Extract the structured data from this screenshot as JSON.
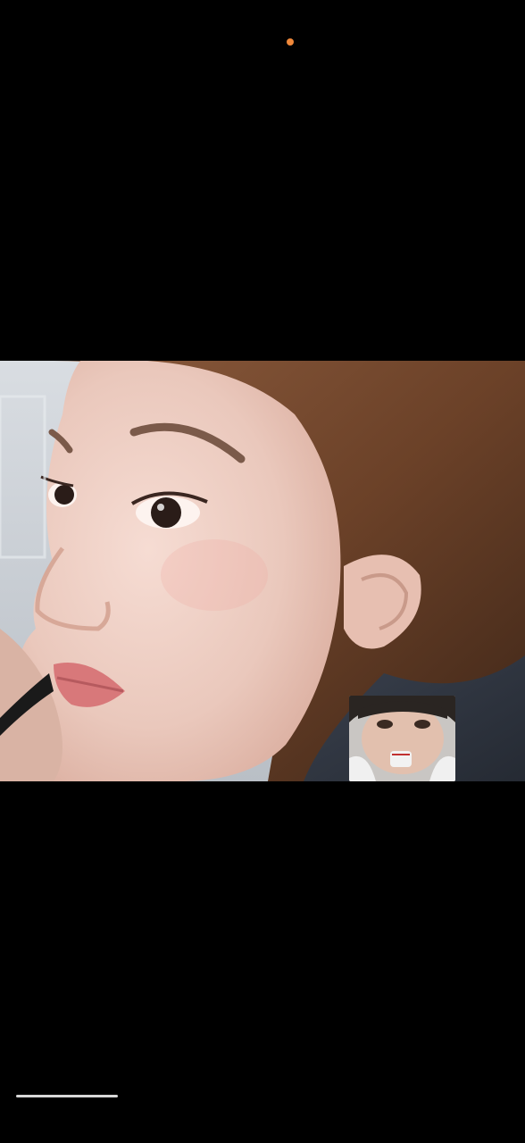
{
  "status": {
    "privacy_indicator": "recording-dot",
    "privacy_indicator_color": "#f0883a"
  },
  "call": {
    "remote_feed": "remote-participant-video",
    "self_feed": "self-camera-preview"
  },
  "system": {
    "home_indicator_color": "#d8d8d8",
    "background_color": "#000000"
  }
}
